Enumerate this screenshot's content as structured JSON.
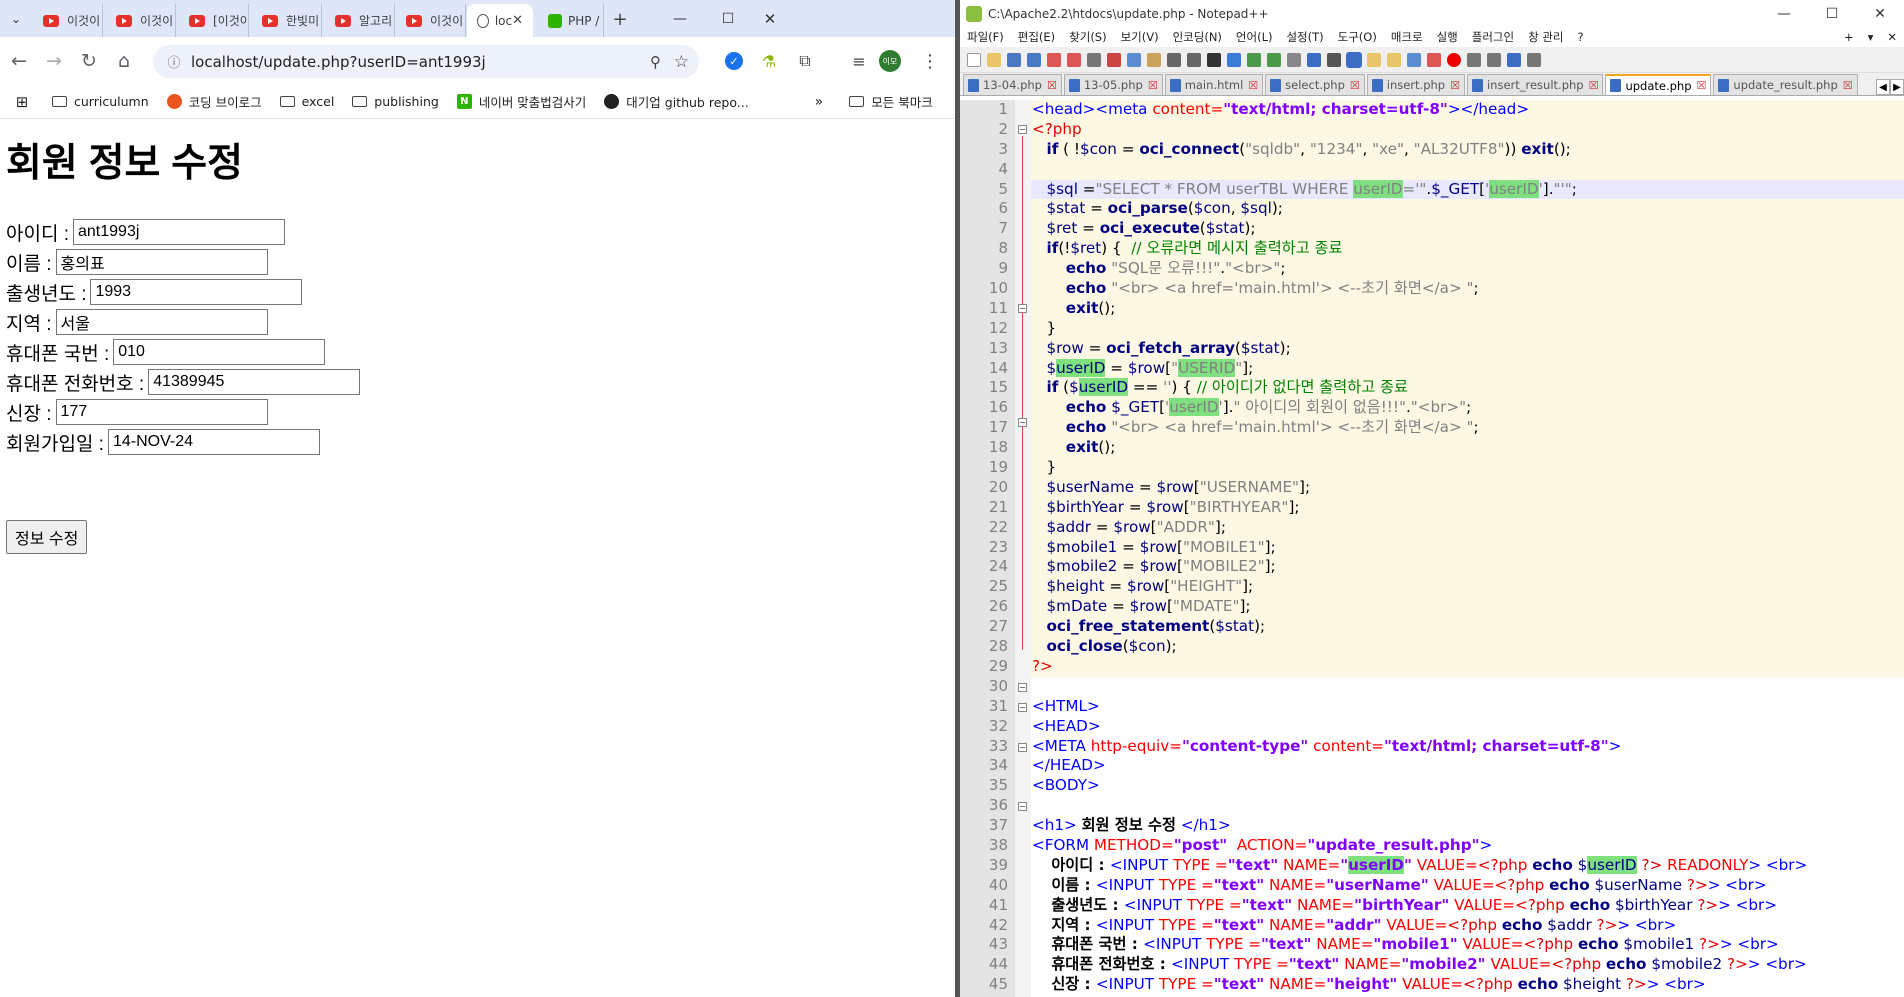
{
  "browser": {
    "tabs": [
      {
        "label": "이것이",
        "favicon": "youtube-icon"
      },
      {
        "label": "이것이",
        "favicon": "youtube-icon"
      },
      {
        "label": "[이것이",
        "favicon": "youtube-icon"
      },
      {
        "label": "한빛미",
        "favicon": "youtube-icon"
      },
      {
        "label": "알고리",
        "favicon": "youtube-icon"
      },
      {
        "label": "이것이",
        "favicon": "youtube-icon"
      },
      {
        "label": "loc",
        "favicon": "globe-icon",
        "active": true
      },
      {
        "label": "PHP /",
        "favicon": "naver-icon"
      }
    ],
    "url": "localhost/update.php?userID=ant1993j",
    "profile_badge": "이모",
    "bookmarks": [
      "curriculumn",
      "코딩 브이로그",
      "excel",
      "publishing",
      "네이버 맞춤법검사기",
      "대기업 github repo...",
      "모든 북마크"
    ]
  },
  "page": {
    "title": "회원 정보 수정",
    "fields": [
      {
        "label": "아이디 :",
        "value": "ant1993j"
      },
      {
        "label": "이름 :",
        "value": "홍의표"
      },
      {
        "label": "출생년도 :",
        "value": "1993"
      },
      {
        "label": "지역 :",
        "value": "서울"
      },
      {
        "label": "휴대폰 국번 :",
        "value": "010"
      },
      {
        "label": "휴대폰 전화번호 :",
        "value": "41389945"
      },
      {
        "label": "신장 :",
        "value": "177"
      },
      {
        "label": "회원가입일 :",
        "value": "14-NOV-24"
      }
    ],
    "submit_label": "정보 수정"
  },
  "notepad": {
    "title": "C:\\Apache2.2\\htdocs\\update.php - Notepad++",
    "menu": [
      "파일(F)",
      "편집(E)",
      "찾기(S)",
      "보기(V)",
      "인코딩(N)",
      "언어(L)",
      "설정(T)",
      "도구(O)",
      "매크로",
      "실행",
      "플러그인",
      "창 관리",
      "?"
    ],
    "tabs": [
      "13-04.php",
      "13-05.php",
      "main.html",
      "select.php",
      "insert.php",
      "insert_result.php",
      "update.php",
      "update_result.php"
    ],
    "active_tab": "update.php",
    "line_numbers": [
      "1",
      "2",
      "3",
      "4",
      "5",
      "6",
      "7",
      "8",
      "9",
      "10",
      "11",
      "12",
      "13",
      "14",
      "15",
      "16",
      "17",
      "18",
      "19",
      "20",
      "21",
      "22",
      "23",
      "24",
      "25",
      "26",
      "27",
      "28",
      "29",
      "30",
      "31",
      "32",
      "33",
      "34",
      "35",
      "36",
      "37",
      "38",
      "39",
      "40",
      "41",
      "42",
      "43",
      "44",
      "45"
    ]
  }
}
